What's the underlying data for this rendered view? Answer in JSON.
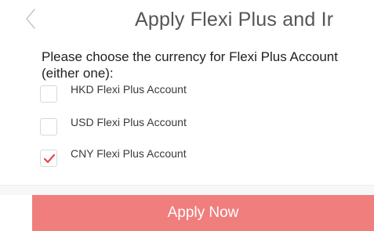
{
  "header": {
    "title": "Apply Flexi Plus and Ir",
    "back_icon": "chevron-left-icon"
  },
  "form": {
    "prompt": "Please choose the currency for Flexi Plus Account (either one):",
    "options": [
      {
        "label": "HKD Flexi Plus Account",
        "checked": false
      },
      {
        "label": "USD Flexi Plus Account",
        "checked": false
      },
      {
        "label": "CNY Flexi Plus Account",
        "checked": true
      }
    ]
  },
  "actions": {
    "apply_label": "Apply Now"
  },
  "colors": {
    "accent": "#f07e7c",
    "check_mark": "#e8474a"
  }
}
